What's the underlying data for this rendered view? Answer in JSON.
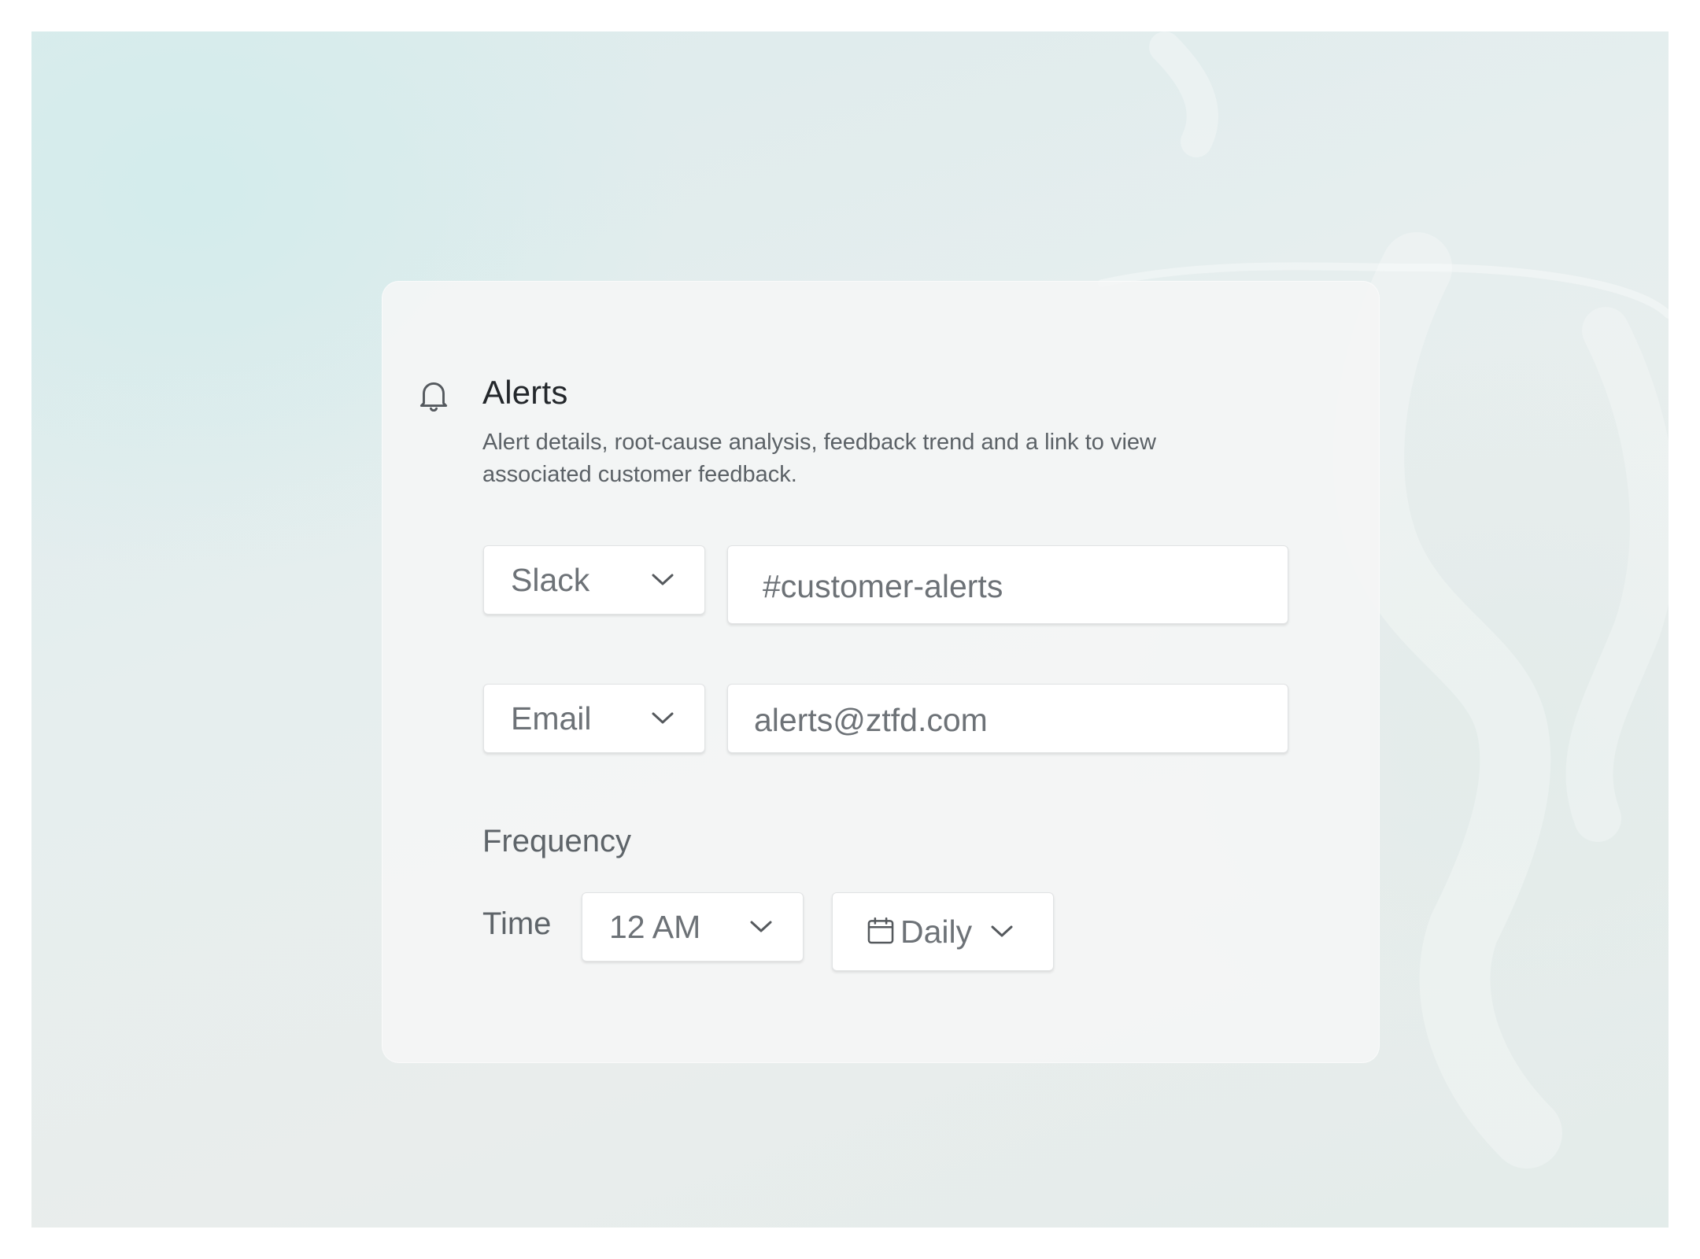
{
  "alerts": {
    "title": "Alerts",
    "description": "Alert details, root-cause analysis, feedback trend and a link to view associated customer feedback.",
    "icon": "bell-icon"
  },
  "channels": [
    {
      "type": "Slack",
      "value": "#customer-alerts"
    },
    {
      "type": "Email",
      "value": "alerts@ztfd.com"
    }
  ],
  "frequency": {
    "section_label": "Frequency",
    "time_label": "Time",
    "time_value": "12 AM",
    "period_value": "Daily",
    "period_icon": "calendar-icon"
  }
}
